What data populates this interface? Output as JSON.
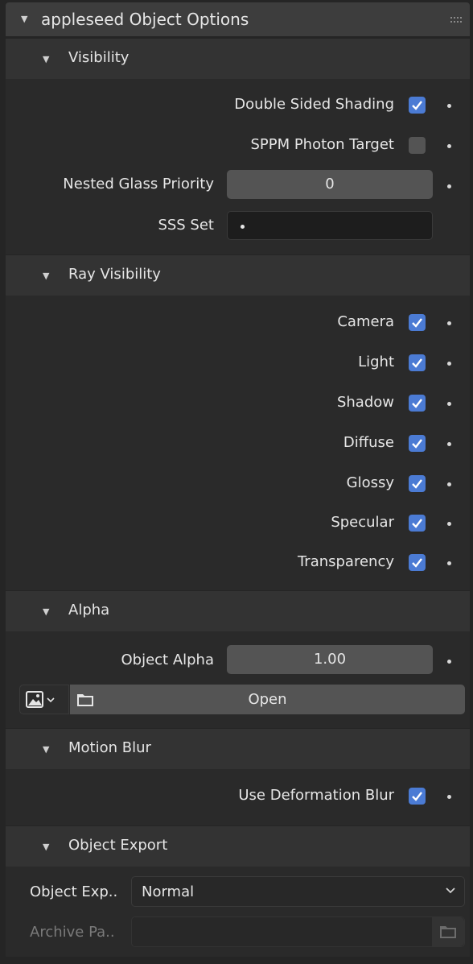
{
  "panel": {
    "title": "appleseed Object Options"
  },
  "visibility": {
    "label": "Visibility",
    "double_sided": {
      "label": "Double Sided Shading",
      "checked": true
    },
    "sppm_target": {
      "label": "SPPM Photon Target",
      "checked": false
    },
    "nested_glass": {
      "label": "Nested Glass Priority",
      "value": "0"
    },
    "sss_set": {
      "label": "SSS Set",
      "value": ""
    }
  },
  "ray_visibility": {
    "label": "Ray Visibility",
    "items": [
      {
        "label": "Camera",
        "checked": true
      },
      {
        "label": "Light",
        "checked": true
      },
      {
        "label": "Shadow",
        "checked": true
      },
      {
        "label": "Diffuse",
        "checked": true
      },
      {
        "label": "Glossy",
        "checked": true
      },
      {
        "label": "Specular",
        "checked": true
      },
      {
        "label": "Transparency",
        "checked": true
      }
    ]
  },
  "alpha": {
    "label": "Alpha",
    "object_alpha": {
      "label": "Object Alpha",
      "value": "1.00"
    },
    "open_label": "Open"
  },
  "motion_blur": {
    "label": "Motion Blur",
    "deformation": {
      "label": "Use Deformation Blur",
      "checked": true
    }
  },
  "object_export": {
    "label": "Object Export",
    "export_type": {
      "label": "Object Exp..",
      "value": "Normal"
    },
    "archive_path": {
      "label": "Archive Pa..",
      "value": ""
    }
  },
  "colors": {
    "accent": "#4b7bd4",
    "field": "#545454",
    "background": "#252525"
  }
}
